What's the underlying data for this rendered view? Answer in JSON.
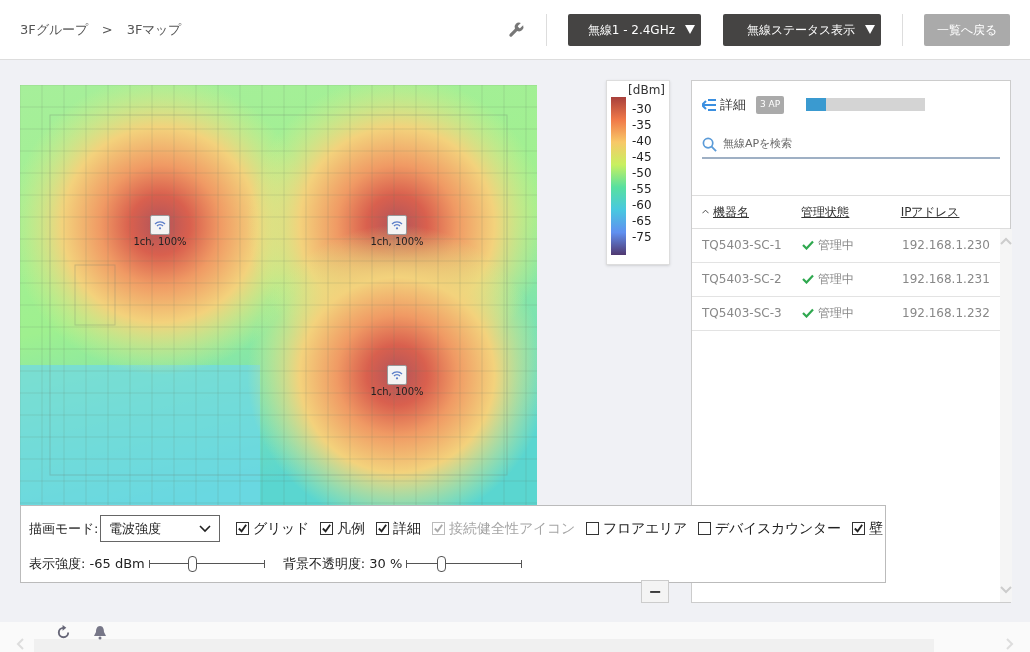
{
  "breadcrumb": [
    {
      "label": "3Fグループ"
    },
    {
      "label": ">"
    },
    {
      "label": "3Fマップ"
    }
  ],
  "header": {
    "band_select": "無線1 - 2.4GHz",
    "status_select": "無線ステータス表示",
    "back_button": {
      "label": "一覧へ戻る",
      "disabled": true
    }
  },
  "map": {
    "access_points": [
      {
        "label": "1ch, 100%"
      },
      {
        "label": "1ch, 100%"
      },
      {
        "label": "1ch, 100%"
      }
    ]
  },
  "legend": {
    "unit": "[dBm]",
    "ticks": [
      "-30",
      "-35",
      "-40",
      "-45",
      "-50",
      "-55",
      "-60",
      "-65",
      "-75"
    ]
  },
  "controls": {
    "mode_label": "描画モード:",
    "mode_value": "電波強度",
    "options": [
      {
        "label": "グリッド",
        "checked": true,
        "disabled": false
      },
      {
        "label": "凡例",
        "checked": true,
        "disabled": false
      },
      {
        "label": "詳細",
        "checked": true,
        "disabled": false
      },
      {
        "label": "接続健全性アイコン",
        "checked": true,
        "disabled": true
      },
      {
        "label": "フロアエリア",
        "checked": false,
        "disabled": false
      },
      {
        "label": "デバイスカウンター",
        "checked": false,
        "disabled": false
      },
      {
        "label": "壁",
        "checked": true,
        "disabled": false
      }
    ],
    "sliders": [
      {
        "label": "表示強度: -65 dBm",
        "level": 0.37
      },
      {
        "label": "背景不透明度: 30 %",
        "level": 0.3
      }
    ]
  },
  "zoom_out": "−",
  "panel": {
    "title": "詳細",
    "count_badge": "3 AP",
    "progress": {
      "level": 0.17
    },
    "search": {
      "placeholder": "無線APを検索"
    },
    "columns": [
      {
        "label": "機器名",
        "sorted": true
      },
      {
        "label": "管理状態",
        "sorted": false
      },
      {
        "label": "IPアドレス",
        "sorted": false
      }
    ],
    "rows": [
      {
        "name": "TQ5403-SC-1",
        "status": "管理中",
        "ip": "192.168.1.230"
      },
      {
        "name": "TQ5403-SC-2",
        "status": "管理中",
        "ip": "192.168.1.231"
      },
      {
        "name": "TQ5403-SC-3",
        "status": "管理中",
        "ip": "192.168.1.232"
      }
    ]
  }
}
